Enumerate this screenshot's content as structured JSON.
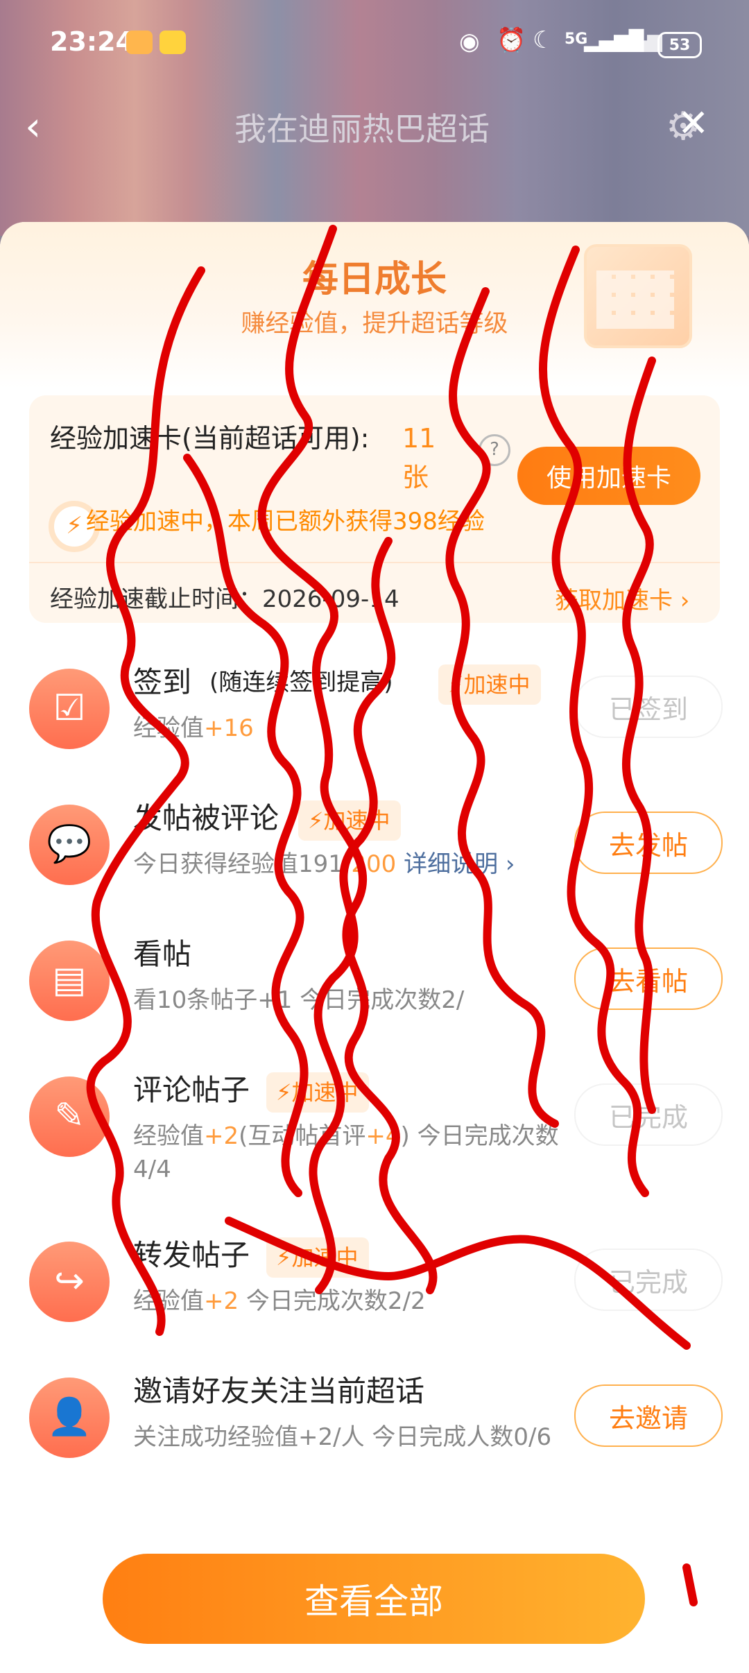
{
  "status_bar": {
    "time": "23:24",
    "network": "5G",
    "battery": "53"
  },
  "top_bar": {
    "title": "我在迪丽热巴超话"
  },
  "sheet": {
    "title": "每日成长",
    "subtitle": "赚经验值，提升超话等级"
  },
  "boost_card": {
    "label": "经验加速卡(当前超话可用):",
    "count": "11张",
    "use_button": "使用加速卡",
    "note": "经验加速中，本周已额外获得398经验",
    "expiry": "经验加速截止时间：2026-09-14",
    "get_link": "获取加速卡 ›"
  },
  "tasks": [
    {
      "title": "签到",
      "hint": "(随连续签到提高)",
      "badge": "⚡加速中",
      "desc_prefix": "经验值",
      "desc_value": "+16",
      "button": "已签到"
    },
    {
      "title": "发帖被评论",
      "badge": "⚡加速中",
      "desc_prefix": "今日获得经验值191/",
      "desc_value": "200",
      "desc_link": "详细说明 ›",
      "button": "去发帖"
    },
    {
      "title": "看帖",
      "desc": "看10条帖子+1  今日完成次数2/",
      "button": "去看帖"
    },
    {
      "title": "评论帖子",
      "badge": "⚡加速中",
      "desc_a": "经验值",
      "desc_b": "+2",
      "desc_c": "(互动帖首评",
      "desc_d": "+4",
      "desc_e": ") 今日完成次数",
      "desc_f": "4/4",
      "button": "已完成"
    },
    {
      "title": "转发帖子",
      "badge": "⚡加速中",
      "desc_prefix": "经验值",
      "desc_value": "+2",
      "desc_suffix": "  今日完成次数2/2",
      "button": "已完成"
    },
    {
      "title": "邀请好友关注当前超话",
      "desc": "关注成功经验值+2/人  今日完成人数0/6",
      "button": "去邀请"
    }
  ],
  "bottom_button": "查看全部",
  "colors": {
    "accent": "#ff7f12",
    "scribble": "#e00000"
  }
}
